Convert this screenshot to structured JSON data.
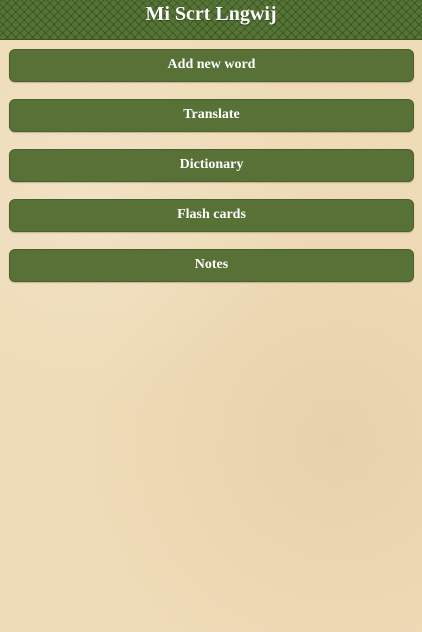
{
  "header": {
    "title": "Mi Scrt Lngwij"
  },
  "menu": {
    "items": [
      {
        "label": "Add new word"
      },
      {
        "label": "Translate"
      },
      {
        "label": "Dictionary"
      },
      {
        "label": "Flash cards"
      },
      {
        "label": "Notes"
      }
    ]
  },
  "colors": {
    "header_green": "#567435",
    "button_green": "#577136",
    "background_paper": "#efdcb7",
    "text": "#ffffff"
  }
}
